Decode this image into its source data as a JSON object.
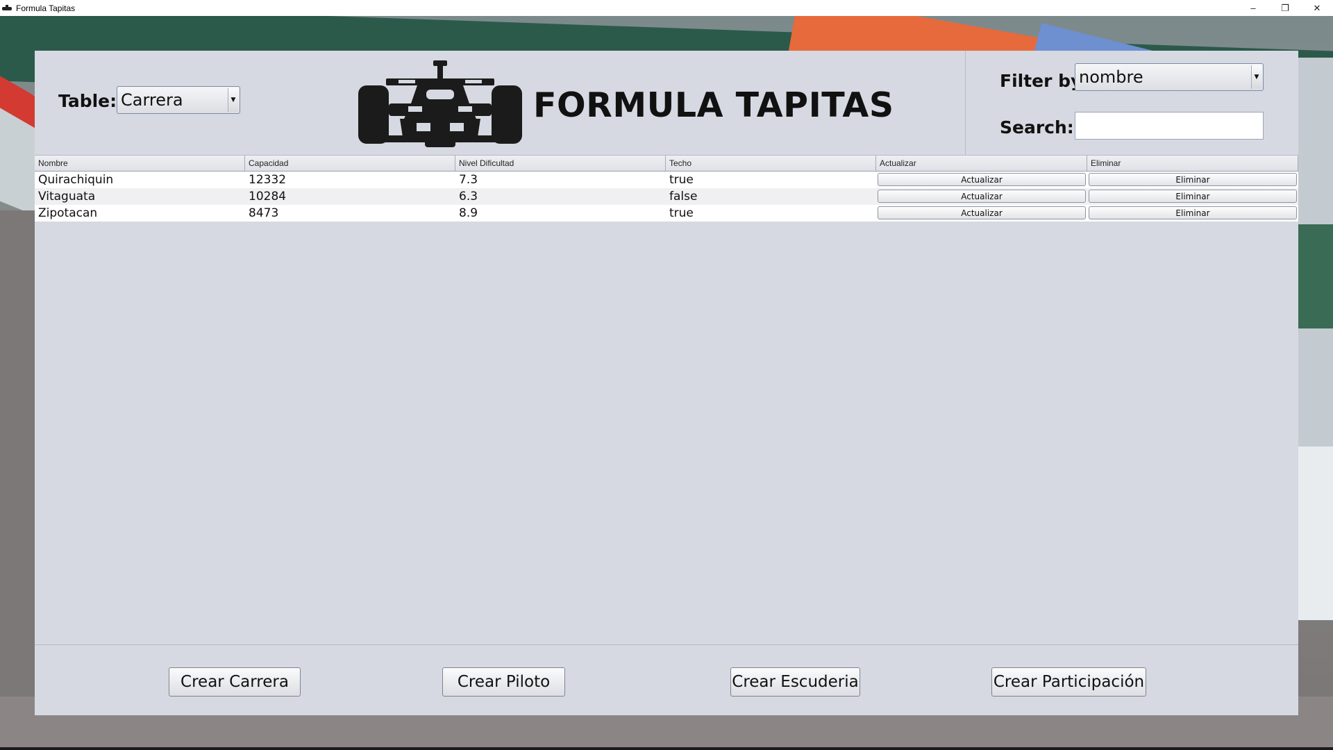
{
  "window": {
    "title": "Formula Tapitas",
    "minimize": "–",
    "maximize": "❐",
    "close": "✕"
  },
  "header": {
    "table_label": "Table:",
    "table_selected": "Carrera",
    "app_title": "FORMULA TAPITAS",
    "filter_label": "Filter by:",
    "filter_selected": "nombre",
    "search_label": "Search:",
    "search_value": ""
  },
  "table": {
    "columns": [
      "Nombre",
      "Capacidad",
      "Nivel Dificultad",
      "Techo",
      "Actualizar",
      "Eliminar"
    ],
    "rows": [
      {
        "nombre": "Quirachiquin",
        "capacidad": "12332",
        "nivel": "7.3",
        "techo": "true",
        "actualizar": "Actualizar",
        "eliminar": "Eliminar"
      },
      {
        "nombre": "Vitaguata",
        "capacidad": "10284",
        "nivel": "6.3",
        "techo": "false",
        "actualizar": "Actualizar",
        "eliminar": "Eliminar"
      },
      {
        "nombre": "Zipotacan",
        "capacidad": "8473",
        "nivel": "8.9",
        "techo": "true",
        "actualizar": "Actualizar",
        "eliminar": "Eliminar"
      }
    ]
  },
  "footer": {
    "crear_carrera": "Crear Carrera",
    "crear_piloto": "Crear Piloto",
    "crear_escuderia": "Crear Escuderia",
    "crear_participacion": "Crear Participación"
  },
  "icons": {
    "logo": "f1-car-icon",
    "dropdown": "chevron-down-icon"
  },
  "colors": {
    "panel": "#d6d9e1",
    "accent_border": "#7a8aa6"
  }
}
